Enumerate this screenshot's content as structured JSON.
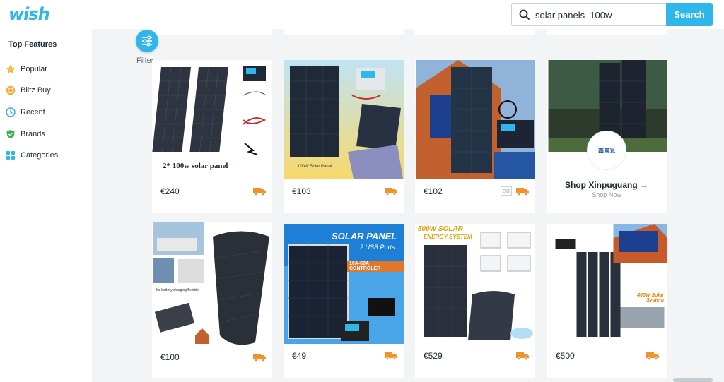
{
  "header": {
    "logo": "wish",
    "search_value": "solar panels  100w",
    "search_button": "Search"
  },
  "sidebar": {
    "title": "Top Features",
    "items": [
      {
        "label": "Popular",
        "icon": "star-icon"
      },
      {
        "label": "Blitz Buy",
        "icon": "blitz-icon"
      },
      {
        "label": "Recent",
        "icon": "clock-icon"
      },
      {
        "label": "Brands",
        "icon": "shield-check-icon"
      },
      {
        "label": "Categories",
        "icon": "grid-icon"
      }
    ]
  },
  "filter": {
    "label": "Filter"
  },
  "products_row1": [
    {
      "price": "€240",
      "caption": "2* 100w solar panel",
      "ad": ""
    },
    {
      "price": "€103",
      "caption": "100W Solar Panel",
      "ad": ""
    },
    {
      "price": "€102",
      "caption": "",
      "ad": "ad"
    }
  ],
  "shop_card": {
    "name": "Shop Xinpuguang",
    "cta": "Shop Now",
    "arrow": "→",
    "logo_text": "鑫普光"
  },
  "products_row2": [
    {
      "price": "€100",
      "caption": "for battery charging/flexible"
    },
    {
      "price": "€49",
      "caption": "SOLAR PANEL",
      "sub": "2 USB Ports",
      "sub2": "10A-60A CONTROLER"
    },
    {
      "price": "€529",
      "caption": "500W SOLAR",
      "sub": "ENERGY SYSTEM"
    },
    {
      "price": "€500",
      "caption": "400W Solar System"
    }
  ],
  "colors": {
    "accent": "#2fb7ec",
    "truck": "#f2922b",
    "background": "#f2f4f5"
  }
}
